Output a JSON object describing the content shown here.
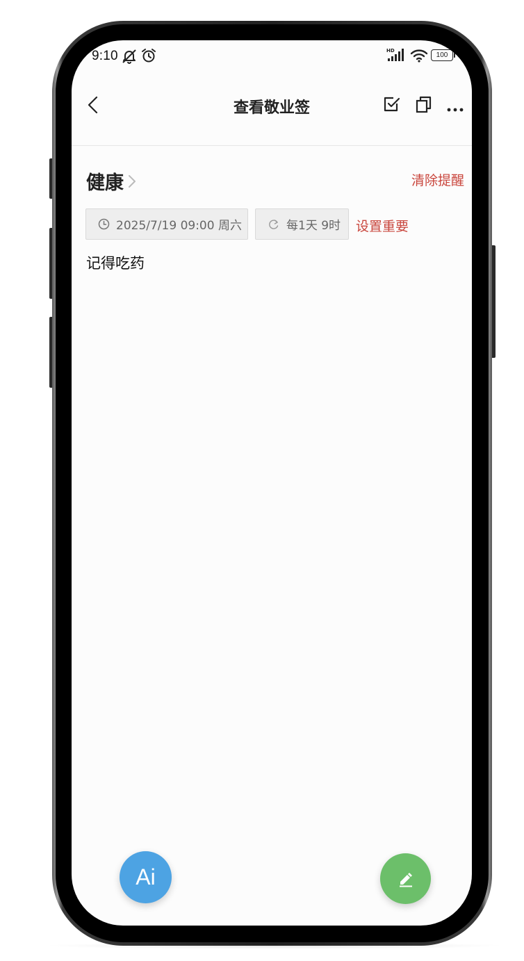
{
  "status_bar": {
    "time": "9:10",
    "icons": [
      "mute-icon",
      "alarm-icon",
      "hd-signal-icon",
      "wifi-icon",
      "battery-icon"
    ],
    "battery_level": "100"
  },
  "nav": {
    "title": "查看敬业签",
    "back_icon": "chevron-left-icon",
    "actions": [
      "checkbox-icon",
      "copy-icon",
      "more-icon"
    ]
  },
  "note": {
    "category": "健康",
    "clear_reminder": "清除提醒",
    "reminder_datetime": "2025/7/19 09:00 周六",
    "repeat": "每1天 9时",
    "set_important": "设置重要",
    "content": "记得吃药"
  },
  "fabs": {
    "ai_label": "Ai",
    "edit_icon": "pen-icon"
  },
  "colors": {
    "accent_red": "#c9463d",
    "ai_blue": "#4da3e3",
    "edit_green": "#6cbf6a",
    "background": "#fcfcfc"
  }
}
